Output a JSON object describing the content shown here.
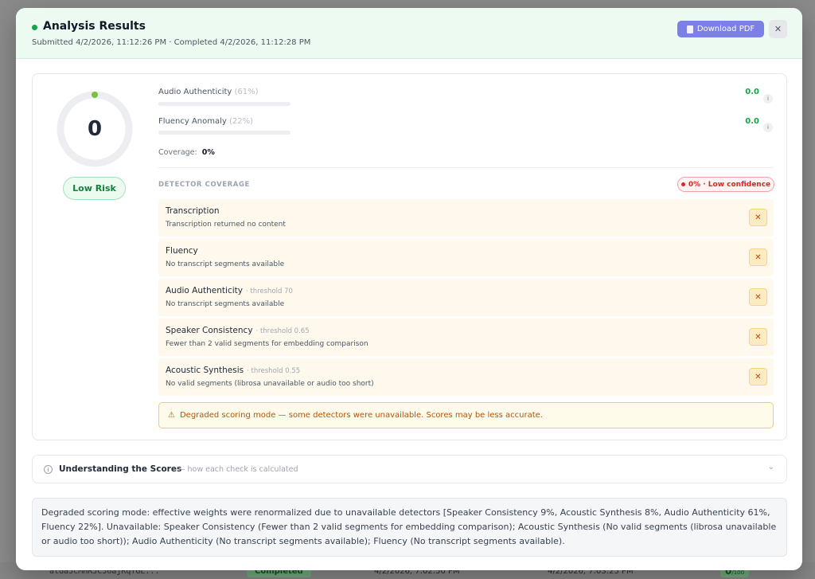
{
  "background_row": {
    "id": "atGa5cMHR5C56ajRqYGL...",
    "status": "Completed",
    "submitted": "4/2/2026, 7:02:50 PM",
    "completed": "4/2/2026, 7:03:25 PM",
    "score": "0",
    "score_suffix": "/100"
  },
  "header": {
    "title": "Analysis Results",
    "subtitle": "Submitted 4/2/2026, 11:12:26 PM · Completed 4/2/2026, 11:12:28 PM",
    "download_label": "Download PDF",
    "close_label": "✕",
    "status_color": "#16a34a"
  },
  "summary": {
    "score": "0",
    "risk_label": "Low Risk",
    "metrics": [
      {
        "label": "Audio Authenticity",
        "weight": "(61%)",
        "value": "0.0",
        "fill": 0
      },
      {
        "label": "Fluency Anomaly",
        "weight": "(22%)",
        "value": "0.0",
        "fill": 0
      }
    ],
    "coverage_label": "Coverage:",
    "coverage_value": "0%",
    "info_icon": "i"
  },
  "detectors": {
    "title": "DETECTOR COVERAGE",
    "confidence_badge": "0% · Low confidence",
    "fail_icon": "✕",
    "items": [
      {
        "name": "Transcription",
        "threshold": "",
        "desc": "Transcription returned no content"
      },
      {
        "name": "Fluency",
        "threshold": "",
        "desc": "No transcript segments available"
      },
      {
        "name": "Audio Authenticity",
        "threshold": "· threshold 70",
        "desc": "No transcript segments available"
      },
      {
        "name": "Speaker Consistency",
        "threshold": "· threshold 0.65",
        "desc": "Fewer than 2 valid segments for embedding comparison"
      },
      {
        "name": "Acoustic Synthesis",
        "threshold": "· threshold 0.55",
        "desc": "No valid segments (librosa unavailable or audio too short)"
      }
    ],
    "warning_icon": "⚠",
    "warning": "Degraded scoring mode — some detectors were unavailable. Scores may be less accurate."
  },
  "understanding": {
    "title": "Understanding the Scores",
    "subtitle": "— how each check is calculated",
    "info_icon": "i",
    "chevron": "⌄"
  },
  "notes": "Degraded scoring mode: effective weights were renormalized due to unavailable detectors [Speaker Consistency 9%, Acoustic Synthesis 8%, Audio Authenticity 61%, Fluency 22%]. Unavailable: Speaker Consistency (Fewer than 2 valid segments for embedding comparison); Acoustic Synthesis (No valid segments (librosa unavailable or audio too short)); Audio Authenticity (No transcript segments available); Fluency (No transcript segments available)."
}
